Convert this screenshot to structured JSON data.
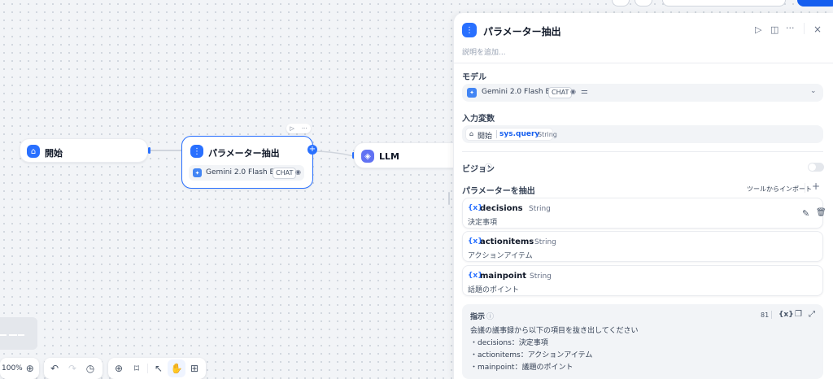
{
  "canvas": {
    "start_node": {
      "title": "開始"
    },
    "param_node": {
      "title": "パラメーター抽出",
      "model_name": "Gemini 2.0 Flash E...",
      "model_tag": "CHAT"
    },
    "llm_node": {
      "title": "LLM"
    }
  },
  "panel": {
    "title": "パラメーター抽出",
    "description_placeholder": "説明を追加...",
    "model": {
      "label": "モデル",
      "name": "Gemini 2.0 Flash Exp",
      "tag": "CHAT"
    },
    "input_var": {
      "label": "入力変数",
      "node": "開始",
      "var": "sys.query",
      "type": "String"
    },
    "vision": {
      "label": "ビジョン",
      "enabled": false
    },
    "extract": {
      "label": "パラメーターを抽出",
      "import_label": "ツールからインポート",
      "params": [
        {
          "name": "decisions",
          "type": "String",
          "desc": "決定事項"
        },
        {
          "name": "actionitems",
          "type": "String",
          "desc": "アクションアイテム"
        },
        {
          "name": "mainpoint",
          "type": "String",
          "desc": "話題のポイント"
        }
      ]
    },
    "instruction": {
      "label": "指示",
      "count": "81",
      "var_glyph": "{x}",
      "lines": [
        "会議の議事録から以下の項目を抜き出してください",
        "・decisions：決定事項",
        "・actionitems：アクションアイテム",
        "・mainpoint：議題のポイント"
      ]
    }
  },
  "toolbar": {
    "zoom": "100%"
  },
  "colors": {
    "accent": "#2970ff",
    "primary": "#155eef",
    "llm": "#6172f3"
  }
}
